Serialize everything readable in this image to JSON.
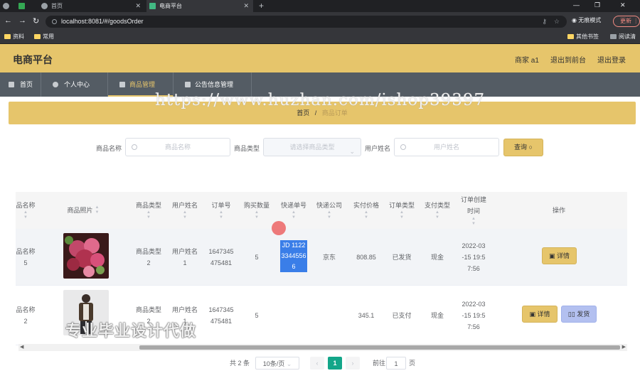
{
  "browser": {
    "tabs": [
      "首页",
      "电商平台"
    ],
    "url": "localhost:8081/#/goodsOrder",
    "incognito_label": "无痕模式",
    "update_label": "更新",
    "bookmarks": [
      "资料",
      "常用"
    ],
    "bookmarks_right": [
      "其他书签",
      "阅读清单"
    ]
  },
  "header": {
    "brand": "电商平台",
    "user": "商家 a1",
    "exit_front": "退出到前台",
    "logout": "退出登录"
  },
  "menu": [
    "首页",
    "个人中心",
    "商品管理",
    "公告信息管理"
  ],
  "breadcrumb": {
    "home": "首页",
    "sep": "/",
    "current": "商品订单"
  },
  "watermark": "https://www.huzhan.com/ishop39397",
  "search": {
    "name_label": "商品名称",
    "name_placeholder": "商品名称",
    "type_label": "商品类型",
    "type_placeholder": "请选择商品类型",
    "user_label": "用户姓名",
    "user_placeholder": "用户姓名",
    "query_button": "查询"
  },
  "table": {
    "headers": [
      "品名称",
      "商品照片",
      "商品类型",
      "用户姓名",
      "订单号",
      "购买数量",
      "快递单号",
      "快递公司",
      "实付价格",
      "订单类型",
      "支付类型",
      "订单创建时间",
      "操作"
    ],
    "rows": [
      {
        "name": "品名称\n5",
        "type": "商品类型\n2",
        "user": "用户姓名\n1",
        "order_no": "1647345\n475481",
        "qty": "5",
        "express_no": "JD 1122\n3344556\n6",
        "express_co": "京东",
        "price": "808.85",
        "order_type": "已发货",
        "pay_type": "现金",
        "created": "2022-03\n-15 19:5\n7:56",
        "actions": [
          "详情"
        ]
      },
      {
        "name": "品名称\n2",
        "type": "商品类型\n2",
        "user": "用户姓名\n1",
        "order_no": "1647345\n475481",
        "qty": "5",
        "express_no": "",
        "express_co": "",
        "price": "345.1",
        "order_type": "已支付",
        "pay_type": "现金",
        "created": "2022-03\n-15 19:5\n7:56",
        "actions": [
          "详情",
          "发货"
        ]
      }
    ]
  },
  "watermark2": "专业毕业设计代做",
  "pagination": {
    "total": "共 2 条",
    "page_size": "10条/页",
    "current": "1",
    "goto_label": "前往",
    "goto_value": "1",
    "page_suffix": "页"
  }
}
